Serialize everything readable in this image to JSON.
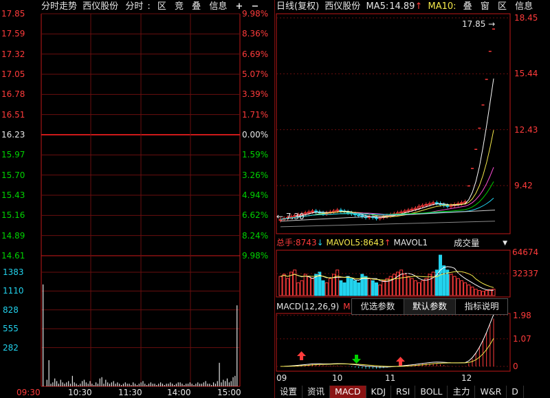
{
  "intraday": {
    "header": {
      "title": "分时走势",
      "stock": "西仪股份",
      "mode": "分时",
      "btn_qu": "区",
      "btn_jing": "竞",
      "btn_die": "叠",
      "btn_info": "信息",
      "btn_plus": "+",
      "btn_minus": "−"
    },
    "price_ticks": [
      "17.85",
      "17.59",
      "17.32",
      "17.05",
      "16.78",
      "16.51",
      "16.23",
      "15.97",
      "15.70",
      "15.43",
      "15.16",
      "14.89",
      "14.61"
    ],
    "pct_ticks": [
      "9.98%",
      "8.36%",
      "6.69%",
      "5.07%",
      "3.39%",
      "1.71%",
      "0.00%",
      "1.59%",
      "3.26%",
      "4.94%",
      "6.62%",
      "8.24%",
      "9.98%"
    ],
    "volume_ticks": [
      "1383",
      "1110",
      "828",
      "555",
      "282"
    ],
    "time_ticks": [
      "09:30",
      "10:30",
      "11:30",
      "14:00",
      "15:00"
    ],
    "volume_bars": [
      0.78,
      0.0,
      0.05,
      0.2,
      0.02,
      0.03,
      0.06,
      0.04,
      0.02,
      0.05,
      0.03,
      0.02,
      0.03,
      0.04,
      0.02,
      0.08,
      0.03,
      0.02,
      0.01,
      0.02,
      0.04,
      0.05,
      0.03,
      0.02,
      0.04,
      0.02,
      0.01,
      0.03,
      0.02,
      0.06,
      0.07,
      0.02,
      0.05,
      0.03,
      0.02,
      0.03,
      0.04,
      0.02,
      0.03,
      0.02,
      0.01,
      0.02,
      0.03,
      0.02,
      0.02,
      0.01,
      0.03,
      0.02,
      0.01,
      0.02,
      0.03,
      0.04,
      0.02,
      0.01,
      0.02,
      0.03,
      0.02,
      0.02,
      0.01,
      0.02,
      0.03,
      0.02,
      0.01,
      0.02,
      0.02,
      0.03,
      0.02,
      0.01,
      0.02,
      0.03,
      0.03,
      0.02,
      0.01,
      0.02,
      0.02,
      0.03,
      0.02,
      0.01,
      0.02,
      0.03,
      0.02,
      0.02,
      0.03,
      0.04,
      0.02,
      0.02,
      0.01,
      0.03,
      0.02,
      0.04,
      0.18,
      0.03,
      0.05,
      0.04,
      0.06,
      0.03,
      0.04,
      0.07,
      0.08,
      0.62
    ]
  },
  "kline": {
    "header": {
      "title": "日线(复权)",
      "stock": "西仪股份",
      "ma5_label": "MA5:",
      "ma5_value": "14.89",
      "ma10_label": "MA10:",
      "btn_die": "叠",
      "btn_chuang": "窗",
      "btn_qu": "区",
      "btn_info": "信息"
    },
    "price_ticks": [
      "18.45",
      "15.44",
      "12.43",
      "9.42"
    ],
    "high_marker": "17.85",
    "low_marker": "7.30",
    "volume_header": {
      "label": "总手:",
      "value": "8743",
      "mavol5_label": "MAVOL5:",
      "mavol5_value": "8643",
      "mavol10_label": "MAVOL1",
      "select_value": "成交量"
    },
    "volume_ticks": [
      "64674",
      "32337"
    ],
    "macd_header": {
      "label": "MACD(12,26,9)",
      "extra": "M"
    },
    "macd_ticks": [
      "1.98",
      "1.07",
      "0"
    ],
    "popup": [
      "优选参数",
      "默认参数",
      "指标说明"
    ],
    "month_ticks": [
      "09",
      "10",
      "11",
      "12"
    ],
    "tabs": [
      "设置",
      "资讯",
      "MACD",
      "KDJ",
      "RSI",
      "BOLL",
      "主力",
      "W&R",
      "D"
    ],
    "active_tab": "MACD",
    "closes": [
      7.6,
      7.65,
      7.7,
      7.75,
      7.8,
      7.85,
      7.9,
      7.95,
      8.0,
      8.05,
      8.0,
      7.95,
      7.9,
      7.95,
      8.0,
      8.05,
      8.1,
      8.05,
      8.0,
      7.95,
      7.9,
      7.85,
      7.8,
      7.75,
      7.7,
      7.75,
      7.7,
      7.65,
      7.7,
      7.75,
      7.8,
      7.85,
      7.9,
      7.95,
      8.0,
      8.05,
      8.1,
      8.15,
      8.2,
      8.3,
      8.35,
      8.4,
      8.45,
      8.5,
      8.45,
      8.4,
      8.35,
      8.3,
      8.35,
      8.4,
      8.45,
      8.5,
      8.55,
      9.4,
      10.34,
      11.37,
      12.51,
      13.76,
      15.14,
      16.65,
      17.85
    ],
    "volumes": [
      0.45,
      0.5,
      0.4,
      0.55,
      0.6,
      0.3,
      0.35,
      0.5,
      0.45,
      0.4,
      0.5,
      0.55,
      0.35,
      0.3,
      0.4,
      0.5,
      0.6,
      0.35,
      0.3,
      0.45,
      0.4,
      0.35,
      0.3,
      0.5,
      0.45,
      0.4,
      0.35,
      0.3,
      0.25,
      0.35,
      0.4,
      0.45,
      0.5,
      0.55,
      0.6,
      0.5,
      0.45,
      0.4,
      0.35,
      0.3,
      0.35,
      0.4,
      0.5,
      0.55,
      0.6,
      0.95,
      0.7,
      0.6,
      0.5,
      0.45,
      0.4,
      0.35,
      0.3,
      0.25,
      0.2,
      0.15,
      0.12,
      0.1,
      0.12,
      0.14,
      0.15
    ],
    "colors": {
      "up": "#ff3b3b",
      "down": "#22d3ee",
      "ma5": "#ffffff",
      "ma10": "#f5e94a",
      "ma20": "#ff4fd8",
      "ma30": "#00d200",
      "ma60": "#22d3ee"
    }
  }
}
